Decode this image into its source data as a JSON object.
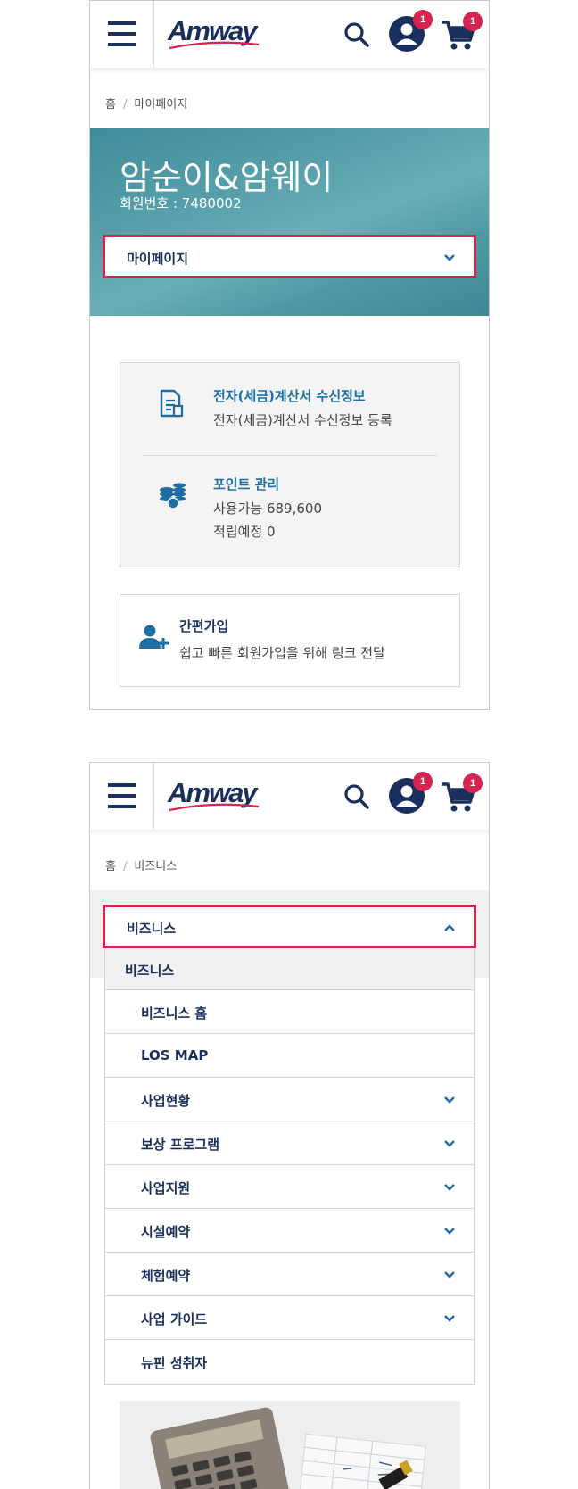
{
  "header": {
    "logo_text": "Amway",
    "account_badge": "1",
    "cart_badge": "1"
  },
  "screen1": {
    "breadcrumb": {
      "home": "홈",
      "sep": "/",
      "current": "마이페이지"
    },
    "profile": {
      "name": "암순이&암웨이",
      "member_no": "회원번호 : 7480002"
    },
    "dropdown_label": "마이페이지",
    "tax_invoice": {
      "title": "전자(세금)계산서 수신정보",
      "subtitle": "전자(세금)계산서 수신정보 등록"
    },
    "points": {
      "title": "포인트 관리",
      "available": "사용가능 689,600",
      "scheduled": "적립예정 0"
    },
    "quick_join": {
      "title": "간편가입",
      "subtitle": "쉽고 빠른 회원가입을 위해 링크 전달"
    }
  },
  "screen2": {
    "breadcrumb": {
      "home": "홈",
      "sep": "/",
      "current": "비즈니스"
    },
    "dropdown_label": "비즈니스",
    "menu_header": "비즈니스",
    "menu_items": [
      {
        "label": "비즈니스 홈"
      },
      {
        "label": "LOS MAP"
      },
      {
        "label": "사업현황"
      },
      {
        "label": "보상 프로그램"
      },
      {
        "label": "사업지원"
      },
      {
        "label": "시설예약"
      },
      {
        "label": "체험예약"
      },
      {
        "label": "사업 가이드"
      },
      {
        "label": "뉴핀 성취자"
      }
    ]
  },
  "colors": {
    "navy": "#1b2f5c",
    "accent_red": "#d6234f",
    "link_blue": "#1d6fa3",
    "hero_teal": "#5ba3ad"
  },
  "icons": [
    "menu-icon",
    "search-icon",
    "user-icon",
    "cart-icon",
    "chevron-down-icon",
    "chevron-up-icon",
    "document-icon",
    "coins-icon",
    "add-user-icon"
  ]
}
